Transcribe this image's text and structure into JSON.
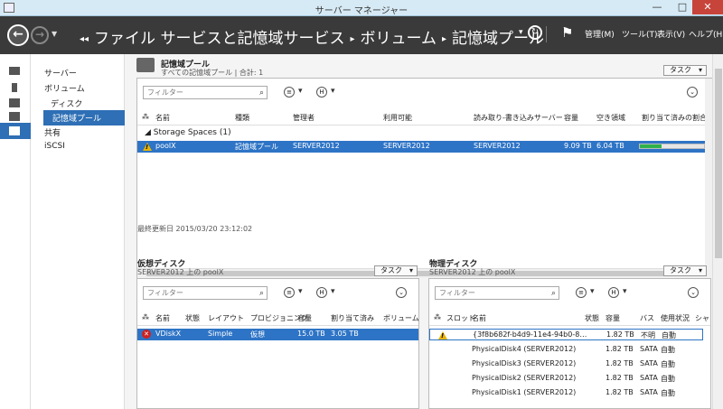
{
  "window": {
    "title": "サーバー マネージャー",
    "min": "—",
    "max": "□",
    "close": "✕"
  },
  "header": {
    "breadcrumb": [
      "ファイル サービスと記憶域サービス",
      "ボリューム",
      "記憶域プール"
    ],
    "menu": [
      "管理(M)",
      "ツール(T)",
      "表示(V)",
      "ヘルプ(H)"
    ]
  },
  "subnav": {
    "items": [
      "サーバー",
      "ボリューム",
      "ディスク",
      "記憶域プール",
      "共有",
      "iSCSI"
    ]
  },
  "pools": {
    "title": "記憶域プール",
    "subtitle": "すべての記憶域プール | 合計: 1",
    "task": "タスク",
    "filter_placeholder": "フィルター",
    "columns": [
      "名前",
      "種類",
      "管理者",
      "利用可能",
      "読み取り-書き込みサーバー",
      "容量",
      "空き領域",
      "割り当て済みの割合"
    ],
    "group": "Storage Spaces (1)",
    "rows": [
      {
        "name": "poolX",
        "type": "記憶域プール",
        "manager": "SERVER2012",
        "available": "SERVER2012",
        "rw_server": "SERVER2012",
        "capacity": "9.09 TB",
        "free": "6.04 TB",
        "allocated_fraction": 0.34
      }
    ],
    "last_updated": "最終更新日 2015/03/20 23:12:02"
  },
  "vdisks": {
    "title": "仮想ディスク",
    "subtitle": "SERVER2012 上の poolX",
    "task": "タスク",
    "filter_placeholder": "フィルター",
    "columns": [
      "名前",
      "状態",
      "レイアウト",
      "プロビジョニング",
      "容量",
      "割り当て済み",
      "ボリューム"
    ],
    "rows": [
      {
        "name": "VDiskX",
        "layout": "Simple",
        "prov": "仮想",
        "capacity": "15.0 TB",
        "allocated": "3.05 TB"
      }
    ]
  },
  "pdisks": {
    "title": "物理ディスク",
    "subtitle": "SERVER2012 上の poolX",
    "task": "タスク",
    "filter_placeholder": "フィルター",
    "columns": [
      "スロット",
      "名前",
      "状態",
      "容量",
      "バス",
      "使用状況",
      "シャ"
    ],
    "rows": [
      {
        "name": "{3f8b682f-b4d9-11e4-94b0-8…",
        "capacity": "1.82 TB",
        "bus": "不明",
        "usage": "自動"
      },
      {
        "name": "PhysicalDisk4 (SERVER2012)",
        "capacity": "1.82 TB",
        "bus": "SATA",
        "usage": "自動"
      },
      {
        "name": "PhysicalDisk3 (SERVER2012)",
        "capacity": "1.82 TB",
        "bus": "SATA",
        "usage": "自動"
      },
      {
        "name": "PhysicalDisk2 (SERVER2012)",
        "capacity": "1.82 TB",
        "bus": "SATA",
        "usage": "自動"
      },
      {
        "name": "PhysicalDisk1 (SERVER2012)",
        "capacity": "1.82 TB",
        "bus": "SATA",
        "usage": "自動"
      }
    ]
  }
}
